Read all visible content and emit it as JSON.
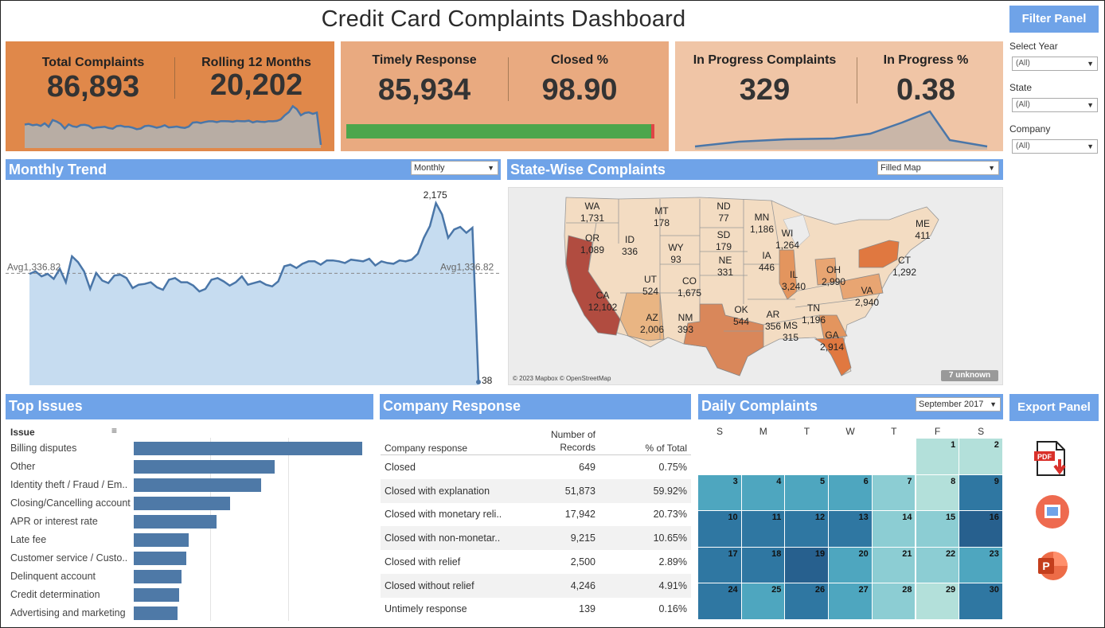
{
  "title": "Credit Card Complaints Dashboard",
  "colors": {
    "accent": "#6fa3e8",
    "kpi1": "#e0884a",
    "kpi2": "#e9aa80",
    "kpi3": "#f0c5a6",
    "bar": "#4e79a7",
    "area_fill": "#c6dcf0",
    "line": "#4a76a8",
    "green": "#4ca64c",
    "red": "#e04545"
  },
  "kpis": {
    "total_label": "Total Complaints",
    "total_value": "86,893",
    "rolling_label": "Rolling 12 Months",
    "rolling_value": "20,202",
    "timely_label": "Timely Response",
    "timely_value": "85,934",
    "closed_label": "Closed %",
    "closed_value": "98.90",
    "inprogress_label": "In Progress Complaints",
    "inprogress_value": "329",
    "inprogress_pct_label": "In Progress %",
    "inprogress_pct_value": "0.38",
    "timely_fraction": 0.989
  },
  "filter_panel": {
    "title": "Filter Panel",
    "filters": [
      {
        "label": "Select Year",
        "value": "(All)"
      },
      {
        "label": "State",
        "value": "(All)"
      },
      {
        "label": "Company",
        "value": "(All)"
      }
    ]
  },
  "export_panel": {
    "title": "Export Panel",
    "items": [
      "pdf-export-icon",
      "image-export-icon",
      "powerpoint-export-icon"
    ]
  },
  "monthly_trend": {
    "title": "Monthly Trend",
    "dropdown": "Monthly",
    "avg_label_left": "Avg1,336.82",
    "avg_label_right": "Avg1,336.82",
    "peak_label": "2,175",
    "last_label": "38"
  },
  "state_map": {
    "title": "State-Wise Complaints",
    "dropdown": "Filled Map",
    "attribution": "© 2023 Mapbox © OpenStreetMap",
    "unknown_badge": "7 unknown",
    "states": [
      {
        "code": "WA",
        "value": "1,731"
      },
      {
        "code": "OR",
        "value": "1,089"
      },
      {
        "code": "ID",
        "value": "336"
      },
      {
        "code": "MT",
        "value": "178"
      },
      {
        "code": "ND",
        "value": "77"
      },
      {
        "code": "SD",
        "value": "179"
      },
      {
        "code": "MN",
        "value": "1,186"
      },
      {
        "code": "WI",
        "value": "1,264"
      },
      {
        "code": "WY",
        "value": "93"
      },
      {
        "code": "NE",
        "value": "331"
      },
      {
        "code": "IA",
        "value": "446"
      },
      {
        "code": "IL",
        "value": "3,240"
      },
      {
        "code": "OH",
        "value": "2,990"
      },
      {
        "code": "CT",
        "value": "1,292"
      },
      {
        "code": "ME",
        "value": "411"
      },
      {
        "code": "CA",
        "value": "12,102"
      },
      {
        "code": "UT",
        "value": "524"
      },
      {
        "code": "CO",
        "value": "1,675"
      },
      {
        "code": "AZ",
        "value": "2,006"
      },
      {
        "code": "NM",
        "value": "393"
      },
      {
        "code": "OK",
        "value": "544"
      },
      {
        "code": "AR",
        "value": "356"
      },
      {
        "code": "MS",
        "value": "315"
      },
      {
        "code": "TN",
        "value": "1,196"
      },
      {
        "code": "VA",
        "value": "2,940"
      },
      {
        "code": "GA",
        "value": "2,914"
      }
    ]
  },
  "top_issues": {
    "title": "Top Issues",
    "column_header": "Issue",
    "items": [
      {
        "label": "Billing disputes",
        "value": 1.0
      },
      {
        "label": "Other",
        "value": 0.615
      },
      {
        "label": "Identity theft / Fraud / Em..",
        "value": 0.559
      },
      {
        "label": "Closing/Cancelling account",
        "value": 0.42
      },
      {
        "label": "APR or interest rate",
        "value": 0.364
      },
      {
        "label": "Late fee",
        "value": 0.24
      },
      {
        "label": "Customer service / Custo..",
        "value": 0.229
      },
      {
        "label": "Delinquent account",
        "value": 0.208
      },
      {
        "label": "Credit determination",
        "value": 0.198
      },
      {
        "label": "Advertising and marketing",
        "value": 0.19
      }
    ]
  },
  "company_response": {
    "title": "Company Response",
    "col1": "Company response",
    "col2a": "Number of",
    "col2b": "Records",
    "col3": "% of Total",
    "rows": [
      {
        "name": "Closed",
        "records": "649",
        "pct": "0.75%"
      },
      {
        "name": "Closed with explanation",
        "records": "51,873",
        "pct": "59.92%"
      },
      {
        "name": "Closed with monetary reli..",
        "records": "17,942",
        "pct": "20.73%"
      },
      {
        "name": "Closed with non-monetar..",
        "records": "9,215",
        "pct": "10.65%"
      },
      {
        "name": "Closed with relief",
        "records": "2,500",
        "pct": "2.89%"
      },
      {
        "name": "Closed without relief",
        "records": "4,246",
        "pct": "4.91%"
      },
      {
        "name": "Untimely response",
        "records": "139",
        "pct": "0.16%"
      }
    ]
  },
  "daily_complaints": {
    "title": "Daily Complaints",
    "dropdown": "September 2017",
    "weekdays": [
      "S",
      "M",
      "T",
      "W",
      "T",
      "F",
      "S"
    ],
    "start_offset": 5,
    "days": [
      {
        "d": "1",
        "level": 0
      },
      {
        "d": "2",
        "level": 0
      },
      {
        "d": "3",
        "level": 2
      },
      {
        "d": "4",
        "level": 2
      },
      {
        "d": "5",
        "level": 2
      },
      {
        "d": "6",
        "level": 2
      },
      {
        "d": "7",
        "level": 1
      },
      {
        "d": "8",
        "level": 0
      },
      {
        "d": "9",
        "level": 3
      },
      {
        "d": "10",
        "level": 3
      },
      {
        "d": "11",
        "level": 3
      },
      {
        "d": "12",
        "level": 3
      },
      {
        "d": "13",
        "level": 3
      },
      {
        "d": "14",
        "level": 1
      },
      {
        "d": "15",
        "level": 1
      },
      {
        "d": "16",
        "level": 4
      },
      {
        "d": "17",
        "level": 3
      },
      {
        "d": "18",
        "level": 3
      },
      {
        "d": "19",
        "level": 4
      },
      {
        "d": "20",
        "level": 2
      },
      {
        "d": "21",
        "level": 1
      },
      {
        "d": "22",
        "level": 1
      },
      {
        "d": "23",
        "level": 2
      },
      {
        "d": "24",
        "level": 3
      },
      {
        "d": "25",
        "level": 2
      },
      {
        "d": "26",
        "level": 3
      },
      {
        "d": "27",
        "level": 2
      },
      {
        "d": "28",
        "level": 1
      },
      {
        "d": "29",
        "level": 0
      },
      {
        "d": "30",
        "level": 3
      }
    ]
  },
  "chart_data": {
    "type": "area",
    "title": "Monthly Trend",
    "xlabel": "",
    "ylabel": "",
    "ylim": [
      0,
      2300
    ],
    "average": 1336.82,
    "values": [
      1330,
      1360,
      1300,
      1330,
      1270,
      1390,
      1230,
      1540,
      1470,
      1360,
      1150,
      1340,
      1250,
      1220,
      1310,
      1320,
      1280,
      1160,
      1200,
      1210,
      1230,
      1170,
      1140,
      1260,
      1280,
      1230,
      1230,
      1190,
      1120,
      1150,
      1260,
      1280,
      1240,
      1190,
      1230,
      1300,
      1200,
      1220,
      1240,
      1200,
      1180,
      1240,
      1420,
      1440,
      1400,
      1450,
      1480,
      1480,
      1440,
      1490,
      1490,
      1480,
      1460,
      1500,
      1490,
      1480,
      1510,
      1430,
      1480,
      1460,
      1450,
      1490,
      1480,
      1500,
      1570,
      1760,
      1900,
      2175,
      2040,
      1760,
      1860,
      1890,
      1820,
      1880,
      38
    ]
  }
}
